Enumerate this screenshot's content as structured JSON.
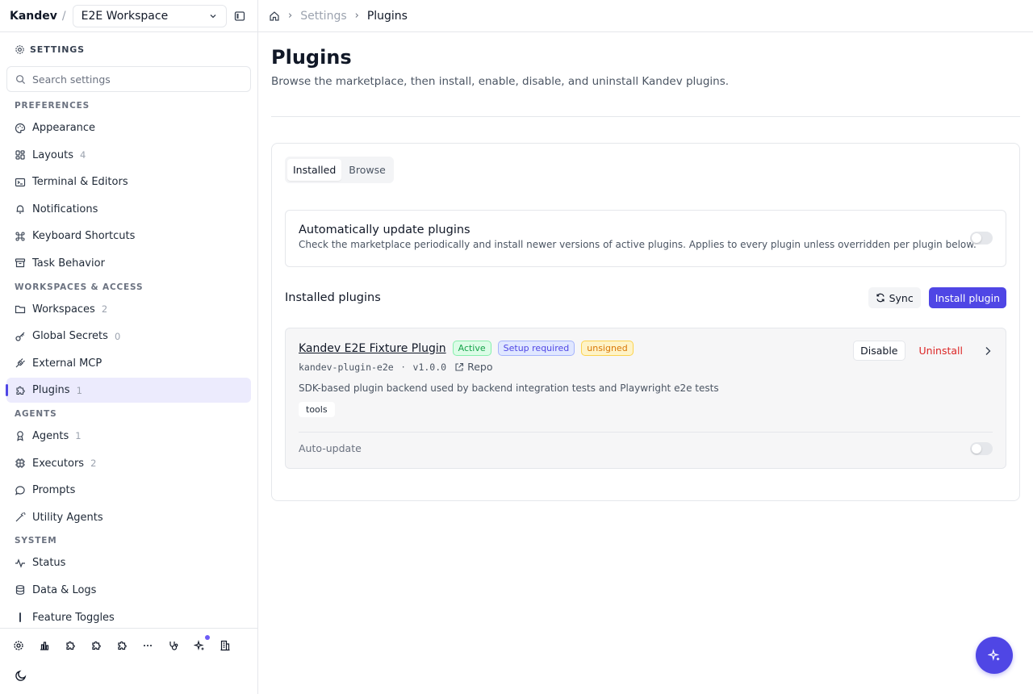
{
  "sidebar": {
    "brand": "Kandev",
    "slash": "/",
    "workspace": "E2E Workspace",
    "settings_title": "SETTINGS",
    "search_placeholder": "Search settings",
    "sections": {
      "preferences": "PREFERENCES",
      "workspaces_access": "WORKSPACES & ACCESS",
      "agents": "AGENTS",
      "system": "SYSTEM"
    },
    "items": {
      "appearance": {
        "label": "Appearance",
        "icon": "palette-icon"
      },
      "layouts": {
        "label": "Layouts",
        "count": "4",
        "icon": "layout-icon"
      },
      "terminal": {
        "label": "Terminal & Editors",
        "icon": "terminal-icon"
      },
      "notifications": {
        "label": "Notifications",
        "icon": "bell-icon"
      },
      "shortcuts": {
        "label": "Keyboard Shortcuts",
        "icon": "command-icon"
      },
      "task_behavior": {
        "label": "Task Behavior",
        "icon": "archive-icon"
      },
      "workspaces": {
        "label": "Workspaces",
        "count": "2",
        "icon": "folder-icon"
      },
      "global_secrets": {
        "label": "Global Secrets",
        "count": "0",
        "icon": "key-icon"
      },
      "external_mcp": {
        "label": "External MCP",
        "icon": "plug-icon"
      },
      "plugins": {
        "label": "Plugins",
        "count": "1",
        "icon": "puzzle-icon"
      },
      "agents": {
        "label": "Agents",
        "count": "1",
        "icon": "bot-icon"
      },
      "executors": {
        "label": "Executors",
        "count": "2",
        "icon": "cpu-icon"
      },
      "prompts": {
        "label": "Prompts",
        "icon": "message-icon"
      },
      "utility_agents": {
        "label": "Utility Agents",
        "icon": "wand-icon"
      },
      "status": {
        "label": "Status",
        "icon": "activity-icon"
      },
      "data_logs": {
        "label": "Data & Logs",
        "icon": "database-icon"
      },
      "feature_toggles": {
        "label": "Feature Toggles",
        "icon": "toggle-icon"
      }
    }
  },
  "breadcrumb": {
    "settings": "Settings",
    "current": "Plugins"
  },
  "page": {
    "title": "Plugins",
    "subtitle": "Browse the marketplace, then install, enable, disable, and uninstall Kandev plugins."
  },
  "tabs": {
    "installed": "Installed",
    "browse": "Browse"
  },
  "auto_update": {
    "title": "Automatically update plugins",
    "description": "Check the marketplace periodically and install newer versions of active plugins. Applies to every plugin unless overridden per plugin below.",
    "enabled": false
  },
  "installed": {
    "title": "Installed plugins",
    "sync_label": "Sync",
    "install_label": "Install plugin"
  },
  "plugin": {
    "name": "Kandev E2E Fixture Plugin",
    "badges": {
      "active": "Active",
      "setup": "Setup required",
      "unsigned": "unsigned"
    },
    "package": "kandev-plugin-e2e",
    "separator": "·",
    "version": "v1.0.0",
    "repo_label": "Repo",
    "description": "SDK-based plugin backend used by backend integration tests and Playwright e2e tests",
    "tag": "tools",
    "auto_update_label": "Auto-update",
    "auto_update_enabled": false,
    "disable_label": "Disable",
    "uninstall_label": "Uninstall"
  },
  "colors": {
    "accent": "#4f46e5",
    "danger": "#dc2626",
    "success": "#16a34a",
    "warning": "#d97706"
  }
}
